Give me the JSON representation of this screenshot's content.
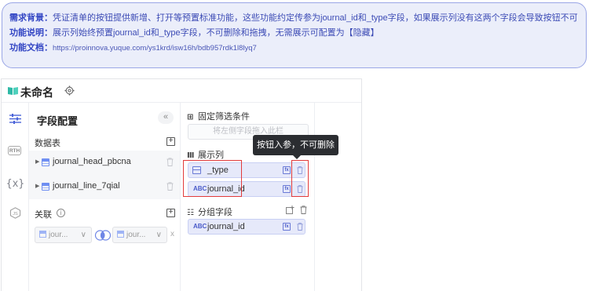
{
  "notice": {
    "bg_label": "需求背景：",
    "bg_text": "凭证清单的按钮提供新增、打开等预置标准功能，这些功能约定传参为journal_id和_type字段，如果展示列没有这两个字段会导致按钮不可用。",
    "func_label": "功能说明：",
    "func_text": "展示列始终预置journal_id和_type字段，不可删除和拖拽，无需展示可配置为【隐藏】",
    "doc_label": "功能文档：",
    "doc_url": "https://proinnova.yuque.com/ys1krd/isw16h/bdb957rdk1l8lyq7"
  },
  "app": {
    "title": "未命名",
    "sidebar": {
      "rth_label": "RTH",
      "var_label": "{x}"
    },
    "field_config": {
      "title": "字段配置",
      "collapse_label": "«",
      "datatable_label": "数据表",
      "add_label": "+",
      "tables": [
        {
          "name": "journal_head_pbcna"
        },
        {
          "name": "journal_line_7qial"
        }
      ],
      "relation_label": "关联",
      "info_label": "i",
      "join_left": "jour...",
      "join_right": "jour...",
      "join_clear": "x"
    },
    "display": {
      "filter_title": "固定筛选条件",
      "filter_placeholder": "将左侧字段拖入此栏",
      "columns_title": "展示列",
      "columns": [
        {
          "icon": "table",
          "name": "_type",
          "fx": "fx"
        },
        {
          "icon": "ABC",
          "name": "journal_id",
          "fx": "fx"
        }
      ],
      "group_title": "分组字段",
      "group_fields": [
        {
          "icon": "ABC",
          "name": "journal_id",
          "fx": "fx"
        }
      ]
    },
    "tooltip": "按钮入参，不可删除"
  },
  "colors": {
    "accent": "#3346c4",
    "notice_bg": "#ebeefa",
    "field_bg": "#e6e9fa",
    "highlight_red": "#e23b3b",
    "tooltip_bg": "#2b2d31"
  }
}
